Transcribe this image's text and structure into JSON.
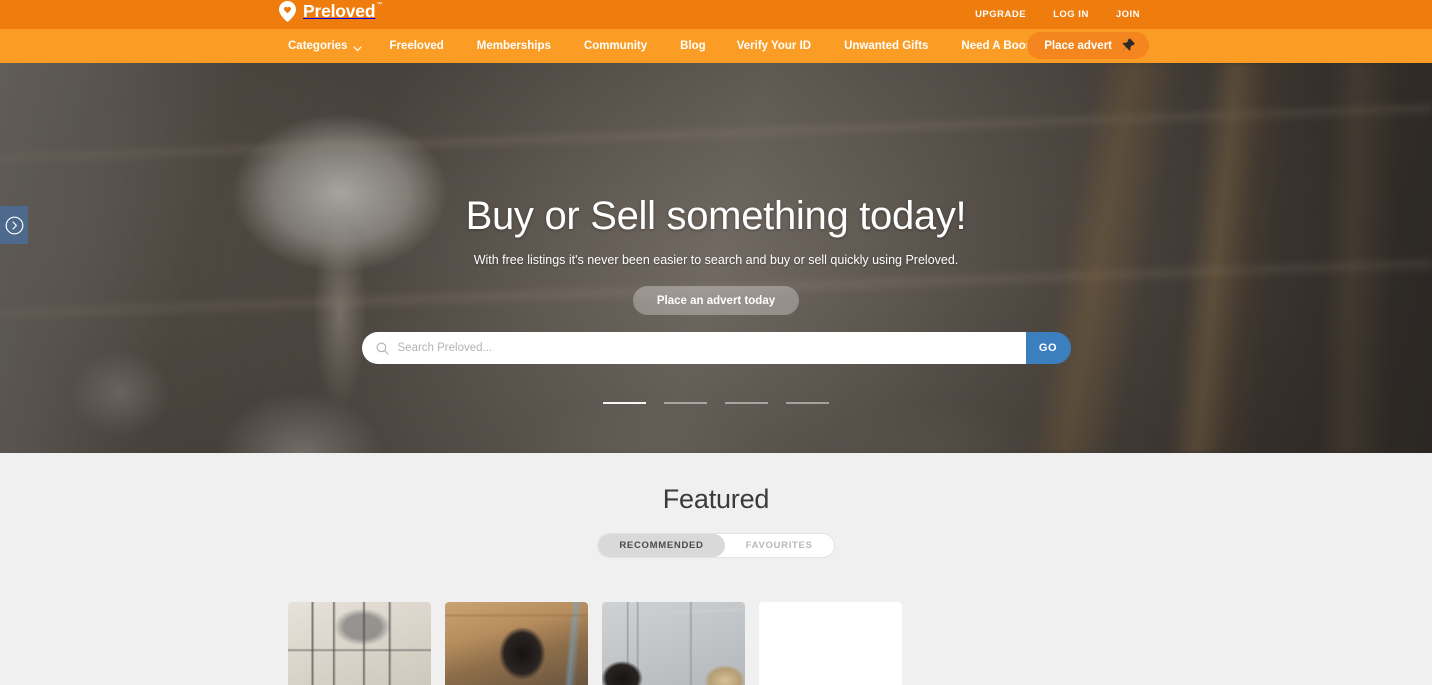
{
  "brand": {
    "name": "Preloved",
    "trademark": "™",
    "logo_icon": "heart-pin-icon",
    "primary_color": "#ef7d0e",
    "nav_color": "#fb9d25",
    "accent_blue": "#3b7fbf"
  },
  "topbar": {
    "links": [
      {
        "label": "UPGRADE",
        "name": "upgrade"
      },
      {
        "label": "LOG IN",
        "name": "log-in"
      },
      {
        "label": "JOIN",
        "name": "join"
      }
    ]
  },
  "nav": {
    "items": [
      {
        "label": "Categories",
        "name": "categories",
        "has_chevron": true
      },
      {
        "label": "Freeloved",
        "name": "freeloved",
        "has_chevron": false
      },
      {
        "label": "Memberships",
        "name": "memberships",
        "has_chevron": false
      },
      {
        "label": "Community",
        "name": "community",
        "has_chevron": false
      },
      {
        "label": "Blog",
        "name": "blog",
        "has_chevron": false
      },
      {
        "label": "Verify Your ID",
        "name": "verify-your-id",
        "has_chevron": false
      },
      {
        "label": "Unwanted Gifts",
        "name": "unwanted-gifts",
        "has_chevron": false
      },
      {
        "label": "Need A Boost?",
        "name": "need-a-boost",
        "has_chevron": false
      }
    ],
    "place_advert": {
      "label": "Place advert",
      "icon": "pushpin-icon"
    }
  },
  "hero": {
    "title": "Buy or Sell something today!",
    "subtitle": "With free listings it's never been easier to search and buy or sell quickly using Preloved.",
    "cta_label": "Place an advert today",
    "search": {
      "placeholder": "Search Preloved...",
      "value": "",
      "icon": "search-icon",
      "submit_label": "GO"
    },
    "carousel": {
      "prev_icon": "chevron-right-circle-icon",
      "slide_count": 4,
      "active_slide": 1
    }
  },
  "featured": {
    "title": "Featured",
    "tabs": [
      {
        "label": "RECOMMENDED",
        "name": "recommended",
        "active": true
      },
      {
        "label": "FAVOURITES",
        "name": "favourites",
        "active": false
      }
    ],
    "cards": [
      {
        "name": "card-bird-cage",
        "style": "img-cage"
      },
      {
        "name": "card-poodle",
        "style": "img-poodle"
      },
      {
        "name": "card-dogs",
        "style": "img-dogs"
      },
      {
        "name": "card-placeholder",
        "style": "img-blank"
      }
    ]
  }
}
